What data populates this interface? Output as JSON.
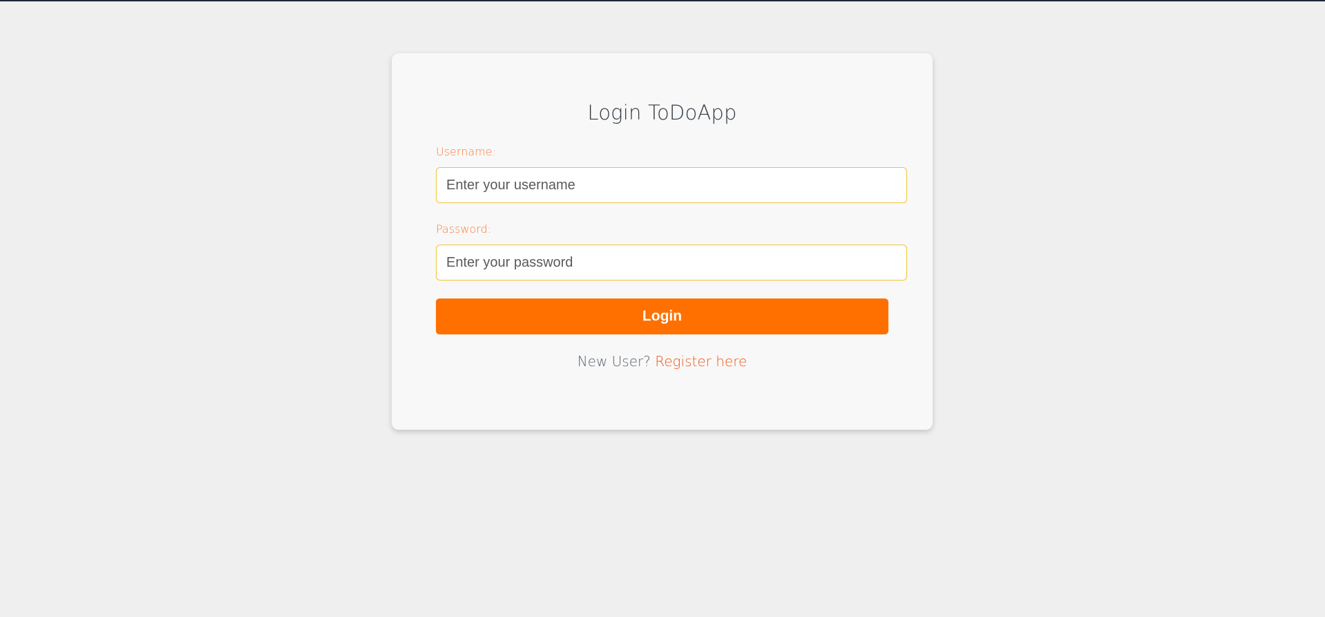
{
  "page": {
    "title": "Login ToDoApp"
  },
  "form": {
    "username": {
      "label": "Username:",
      "placeholder": "Enter your username",
      "value": ""
    },
    "password": {
      "label": "Password:",
      "placeholder": "Enter your password",
      "value": ""
    },
    "submit_label": "Login"
  },
  "footer": {
    "prompt_text": "New User?",
    "register_link": "Register here"
  },
  "colors": {
    "page_background": "#efefef",
    "card_background": "#f8f8f8",
    "accent_orange": "#ff7000",
    "label_orange": "#ff7a3d",
    "link_orange": "#f2591c",
    "input_border": "#f1c232"
  }
}
